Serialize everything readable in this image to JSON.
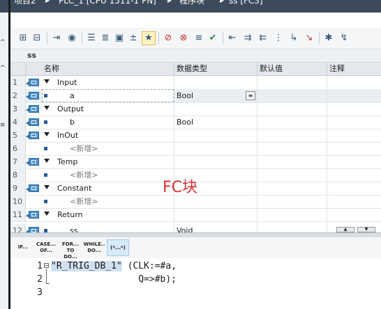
{
  "window": {
    "breadcrumb": [
      "项目2",
      "PLC_1 [CPU 1511-1 PN]",
      "程序块",
      "ss [FC3]"
    ]
  },
  "toolbar": {
    "icons": [
      "insert-row-icon",
      "add-row-icon",
      "jump-to-icon",
      "monitor-icon",
      "indent-icon",
      "outdent-icon",
      "block-call-icon",
      "breakpoint-icon",
      "highlight-icon",
      "comment-icon",
      "uncomment-icon",
      "align-icon",
      "check-icon",
      "left-indent-icon",
      "right-indent-icon",
      "format-icon",
      "watch-icon",
      "status-icon",
      "snapshot-icon",
      "bookmark-icon",
      "go-icon"
    ]
  },
  "block": {
    "name": "ss"
  },
  "interface_table": {
    "columns": [
      "名称",
      "数据类型",
      "默认值",
      "注释"
    ],
    "rows": [
      {
        "num": "1",
        "name": "Input",
        "type": "",
        "kind": "section"
      },
      {
        "num": "2",
        "name": "a",
        "type": "Bool",
        "kind": "var"
      },
      {
        "num": "3",
        "name": "Output",
        "type": "",
        "kind": "section"
      },
      {
        "num": "4",
        "name": "b",
        "type": "Bool",
        "kind": "var"
      },
      {
        "num": "5",
        "name": "InOut",
        "type": "",
        "kind": "section"
      },
      {
        "num": "6",
        "name": "<新增>",
        "type": "",
        "kind": "add"
      },
      {
        "num": "7",
        "name": "Temp",
        "type": "",
        "kind": "section"
      },
      {
        "num": "8",
        "name": "<新增>",
        "type": "",
        "kind": "add"
      },
      {
        "num": "9",
        "name": "Constant",
        "type": "",
        "kind": "section"
      },
      {
        "num": "10",
        "name": "<新增>",
        "type": "",
        "kind": "add"
      },
      {
        "num": "11",
        "name": "Return",
        "type": "",
        "kind": "section"
      },
      {
        "num": "12",
        "name": "ss",
        "type": "Void",
        "kind": "var"
      }
    ]
  },
  "annotation": {
    "text": "FC块",
    "color": "#e03030"
  },
  "snippets": [
    {
      "line1": "IF...",
      "line2": ""
    },
    {
      "line1": "CASE...",
      "line2": "OF..."
    },
    {
      "line1": "FOR...",
      "line2": "TO DO..."
    },
    {
      "line1": "WHILE..",
      "line2": "DO..."
    },
    {
      "line1": "(*...*)",
      "line2": ""
    }
  ],
  "code": {
    "line_numbers": [
      "1",
      "2",
      "3"
    ],
    "line1_fb": "\"R_TRIG_DB_1\"",
    "line1_rest": " (CLK:=#a,",
    "line2": "                Q=>#b);"
  },
  "left_markers": [
    "^",
    "≡",
    "^"
  ]
}
